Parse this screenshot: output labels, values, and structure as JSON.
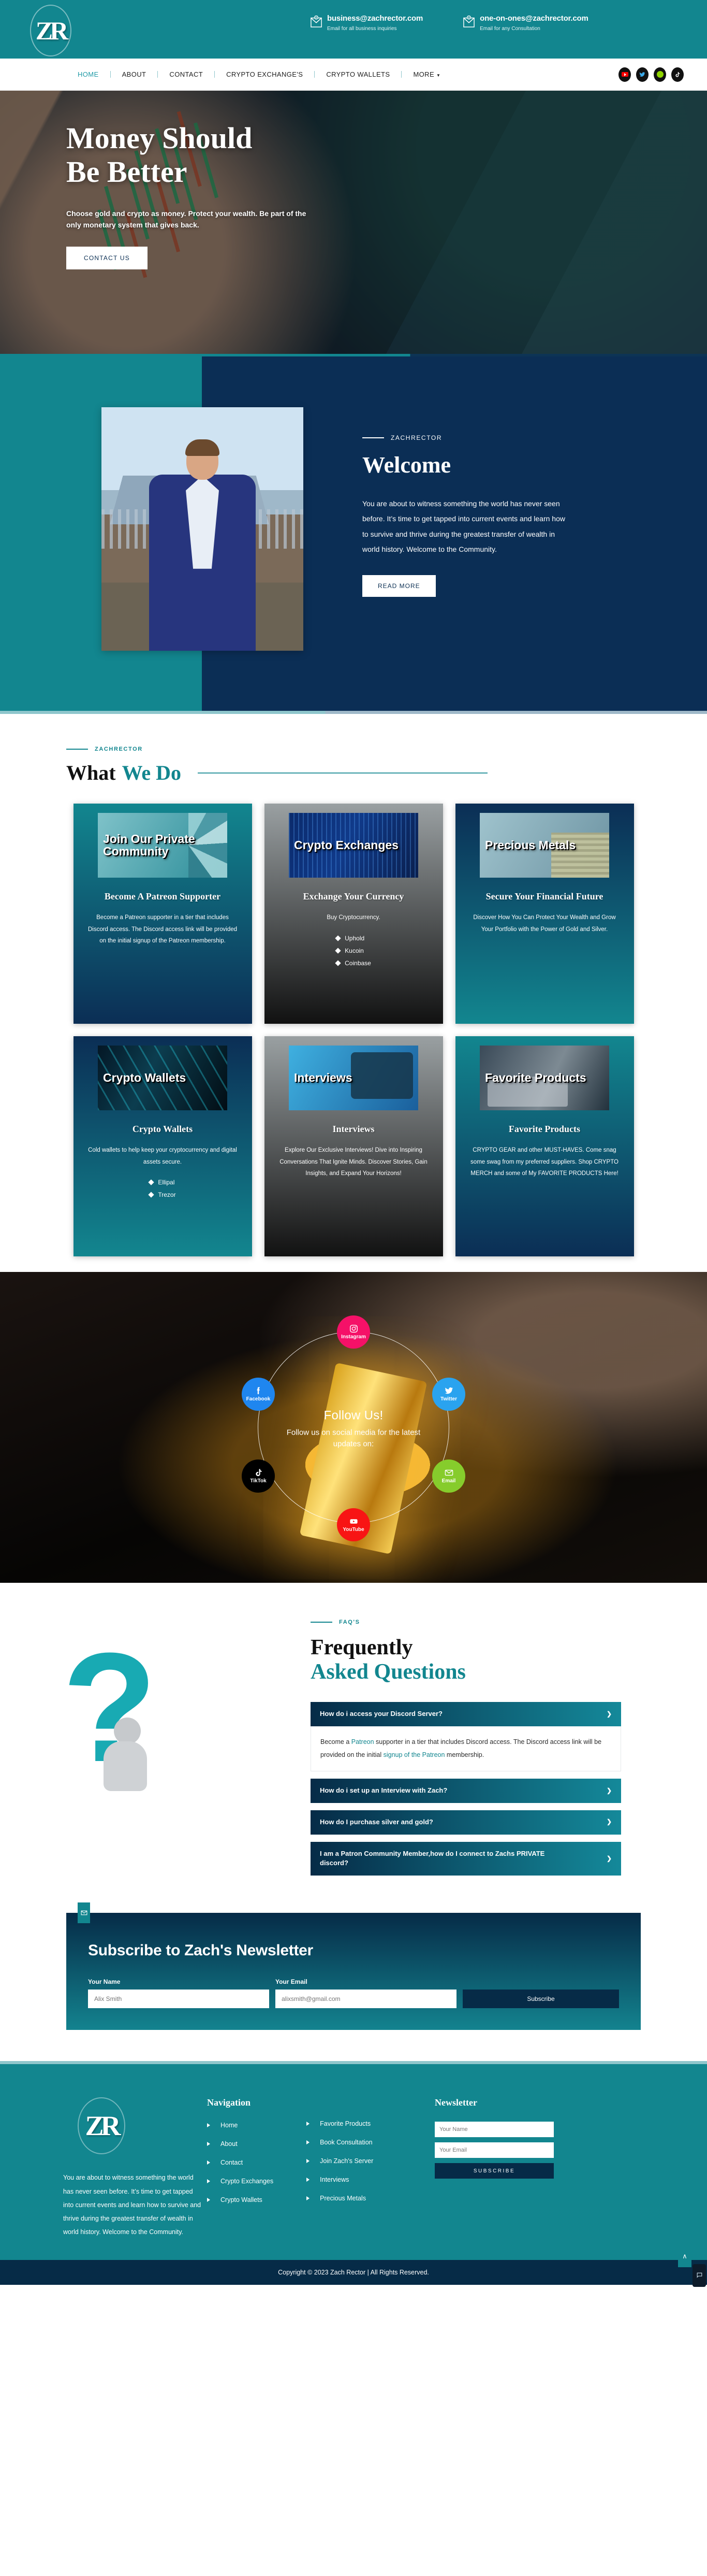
{
  "brand": {
    "logo_text": "ZR",
    "accent_teal": "#12868f",
    "accent_navy": "#062b47"
  },
  "topbar": {
    "contacts": [
      {
        "icon": "envelope-at-icon",
        "email": "business@zachrector.com",
        "note": "Email for all business inquiries"
      },
      {
        "icon": "envelope-at-icon",
        "email": "one-on-ones@zachrector.com",
        "note": "Email for any Consultation"
      }
    ]
  },
  "nav": {
    "items": [
      {
        "label": "HOME",
        "active": true
      },
      {
        "label": "ABOUT",
        "active": false
      },
      {
        "label": "CONTACT",
        "active": false
      },
      {
        "label": "CRYPTO EXCHANGE'S",
        "active": false
      },
      {
        "label": "CRYPTO WALLETS",
        "active": false
      },
      {
        "label": "MORE",
        "active": false,
        "caret": "▼"
      }
    ],
    "socials": [
      "youtube-icon",
      "twitter-icon",
      "discord-icon",
      "tiktok-icon"
    ]
  },
  "hero": {
    "heading": "Money Should Be Better",
    "paragraph": "Choose gold and crypto as money. Protect your wealth. Be part of the only monetary system that gives back.",
    "cta": "CONTACT US"
  },
  "welcome": {
    "eyebrow": "ZACHRECTOR",
    "title": "Welcome",
    "text": "You are about to witness something the world has never seen before. It’s time to get tapped into current events and learn how to survive and thrive during the greatest transfer of wealth in world history. Welcome to the Community.",
    "cta": "READ MORE"
  },
  "whatwedo": {
    "eyebrow": "ZACHRECTOR",
    "title_dark": "What",
    "title_teal": "We Do",
    "cards": [
      {
        "thumb_title": "Join Our Private Community",
        "title": "Become A Patreon Supporter",
        "text": "Become a Patreon supporter in a tier that includes Discord access. The Discord access link will be provided on the initial signup of the Patreon membership.",
        "list": []
      },
      {
        "thumb_title": "Crypto Exchanges",
        "title": "Exchange Your Currency",
        "text": "Buy Cryptocurrency.",
        "list": [
          "Uphold",
          "Kucoin",
          "Coinbase"
        ]
      },
      {
        "thumb_title": "Precious Metals",
        "title": "Secure Your Financial Future",
        "text": "Discover How You Can Protect Your Wealth and Grow Your Portfolio with the Power of Gold and Silver.",
        "list": []
      },
      {
        "thumb_title": "Crypto Wallets",
        "title": "Crypto Wallets",
        "text": "Cold wallets to help keep your cryptocurrency and digital assets secure.",
        "list": [
          "Ellipal",
          "Trezor"
        ]
      },
      {
        "thumb_title": "Interviews",
        "title": "Interviews",
        "text": "Explore Our Exclusive Interviews! Dive into Inspiring Conversations That Ignite Minds. Discover Stories, Gain Insights, and Expand Your Horizons!",
        "list": []
      },
      {
        "thumb_title": "Favorite Products",
        "title": "Favorite Products",
        "text": "CRYPTO GEAR and other MUST-HAVES. Come snag some swag from my preferred suppliers. Shop CRYPTO MERCH and some of My FAVORITE PRODUCTS Here!",
        "list": []
      }
    ]
  },
  "follow": {
    "heading": "Follow Us!",
    "subtext": "Follow us on social media for the latest updates on:",
    "nodes": [
      {
        "label": "Instagram",
        "icon": "instagram-icon",
        "color": "#f51168"
      },
      {
        "label": "Facebook",
        "icon": "facebook-icon",
        "color": "#1f86ef"
      },
      {
        "label": "Twitter",
        "icon": "twitter-icon",
        "color": "#2aa3ef"
      },
      {
        "label": "TikTok",
        "icon": "tiktok-icon",
        "color": "#000000"
      },
      {
        "label": "Email",
        "icon": "envelope-icon",
        "color": "#86cc2c"
      },
      {
        "label": "YouTube",
        "icon": "youtube-icon",
        "color": "#f81414"
      }
    ]
  },
  "faq": {
    "eyebrow": "FAQ'S",
    "title_line1": "Frequently",
    "title_line2": "Asked Questions",
    "items": [
      {
        "question": "How do i access your Discord Server?",
        "open": true,
        "answer_pre": "Become a ",
        "answer_link1": "Patreon",
        "answer_mid": " supporter in a tier that includes Discord access. The Discord access link will be provided on the initial ",
        "answer_link2": "signup of the Patreon",
        "answer_post": " membership."
      },
      {
        "question": "How do i set up an Interview with Zach?",
        "open": false
      },
      {
        "question": "How do I purchase silver and gold?",
        "open": false
      },
      {
        "question": "I am a Patron Community Member,how do I connect to Zachs PRIVATE discord?",
        "open": false
      }
    ]
  },
  "newsletter": {
    "heading": "Subscribe to Zach's Newsletter",
    "name_label": "Your Name",
    "name_placeholder": "Alix Smith",
    "email_label": "Your Email",
    "email_placeholder": "alixsmith@gmail.com",
    "button": "Subscribe",
    "tab_icon": "envelope-icon"
  },
  "footer": {
    "about": "You are about to witness something the world has never seen before. It’s time to get tapped into current events and learn how to survive and thrive during the greatest transfer of wealth in world history. Welcome to the Community.",
    "nav_heading": "Navigation",
    "nav_links_col1": [
      "Home",
      "About",
      "Contact",
      "Crypto Exchanges",
      "Crypto Wallets"
    ],
    "nav_links_col2": [
      "Favorite Products",
      "Book Consultation",
      "Join Zach's Server",
      "Interviews",
      "Precious Metals"
    ],
    "newsletter_heading": "Newsletter",
    "name_placeholder": "Your Name",
    "email_placeholder": "Your Email",
    "subscribe_button": "SUBSCRIBE",
    "copyright": "Copyright © 2023 Zach Rector | All Rights Reserved.",
    "to_top": "∧",
    "chat_icon": "chat-icon"
  }
}
